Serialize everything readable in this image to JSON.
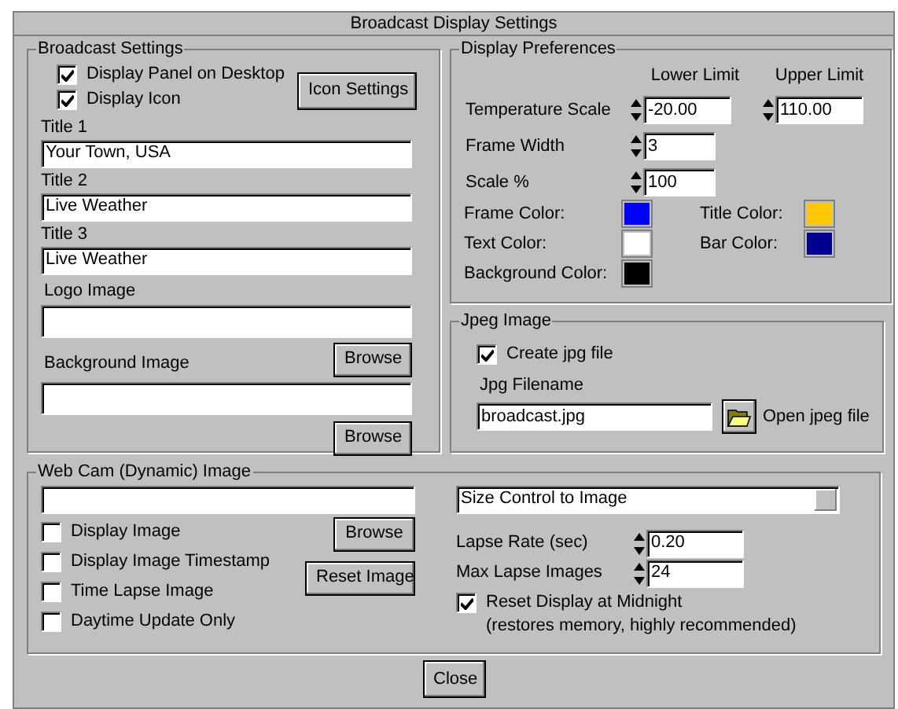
{
  "window": {
    "title": "Broadcast Display Settings"
  },
  "broadcast_settings": {
    "title": "Broadcast Settings",
    "checkboxes": [
      {
        "label": "Display Panel on Desktop",
        "checked": true
      },
      {
        "label": "Display Icon",
        "checked": true
      }
    ],
    "icon_settings_button": "Icon Settings",
    "titles": [
      {
        "label": "Title 1",
        "value": "Your Town, USA"
      },
      {
        "label": "Title 2",
        "value": "Live Weather"
      },
      {
        "label": "Title 3",
        "value": "Live Weather"
      }
    ],
    "logo_image": {
      "label": "Logo Image",
      "button": "Browse"
    },
    "background_image": {
      "label": "Background Image",
      "button": "Browse"
    }
  },
  "display_preferences": {
    "title": "Display Preferences",
    "lower_limit_header": "Lower Limit",
    "upper_limit_header": "Upper Limit",
    "temperature_scale": {
      "label": "Temperature Scale",
      "lower": "-20.00",
      "upper": "110.00"
    },
    "frame_width": {
      "label": "Frame Width",
      "value": "3"
    },
    "scale": {
      "label": "Scale %",
      "value": "100"
    },
    "colors": [
      {
        "label": "Frame Color:",
        "color": "#0000ff"
      },
      {
        "label": "Title Color:",
        "color": "#ffc800"
      },
      {
        "label": "Text Color:",
        "color": "#ffffff"
      },
      {
        "label": "Bar Color:",
        "color": "#000090"
      },
      {
        "label": "Background Color:",
        "color": "#000000"
      }
    ]
  },
  "jpeg_image": {
    "title": "Jpeg Image",
    "create_checkbox": {
      "label": "Create jpg file",
      "checked": true
    },
    "filename_label": "Jpg Filename",
    "filename": "broadcast.jpg",
    "open_label": "Open jpeg file"
  },
  "webcam": {
    "title": "Web Cam (Dynamic) Image",
    "checkboxes": [
      {
        "label": "Display Image",
        "checked": false
      },
      {
        "label": "Display Image Timestamp",
        "checked": false
      },
      {
        "label": "Time Lapse Image",
        "checked": false
      },
      {
        "label": "Daytime Update Only",
        "checked": false
      }
    ],
    "browse_button": "Browse",
    "reset_button": "Reset Image",
    "size_dropdown": "Size Control to Image",
    "lapse_rate": {
      "label": "Lapse Rate (sec)",
      "value": "0.20"
    },
    "max_lapse": {
      "label": "Max Lapse Images",
      "value": "24"
    },
    "reset_checkbox": {
      "label": "Reset Display at Midnight",
      "checked": true
    },
    "reset_note": "(restores memory, highly recommended)"
  },
  "close_button": "Close"
}
